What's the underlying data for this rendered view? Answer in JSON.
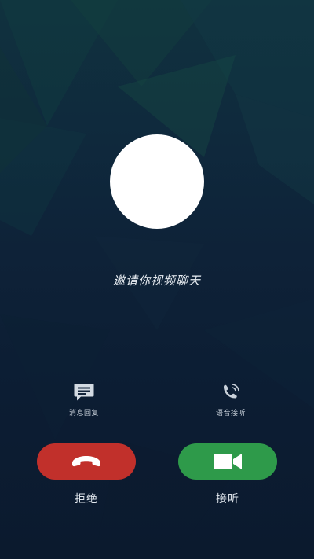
{
  "screen": {
    "invite_text": "邀请你视频聊天"
  },
  "quick_actions": {
    "message_reply": {
      "label": "消息回复",
      "icon": "message-icon"
    },
    "voice_answer": {
      "label": "语音接听",
      "icon": "phone-ringing-icon"
    }
  },
  "call_buttons": {
    "decline": {
      "label": "拒绝",
      "icon": "phone-hangup-icon",
      "color": "#c1302b"
    },
    "accept": {
      "label": "接听",
      "icon": "video-camera-icon",
      "color": "#2e9a4a"
    }
  }
}
